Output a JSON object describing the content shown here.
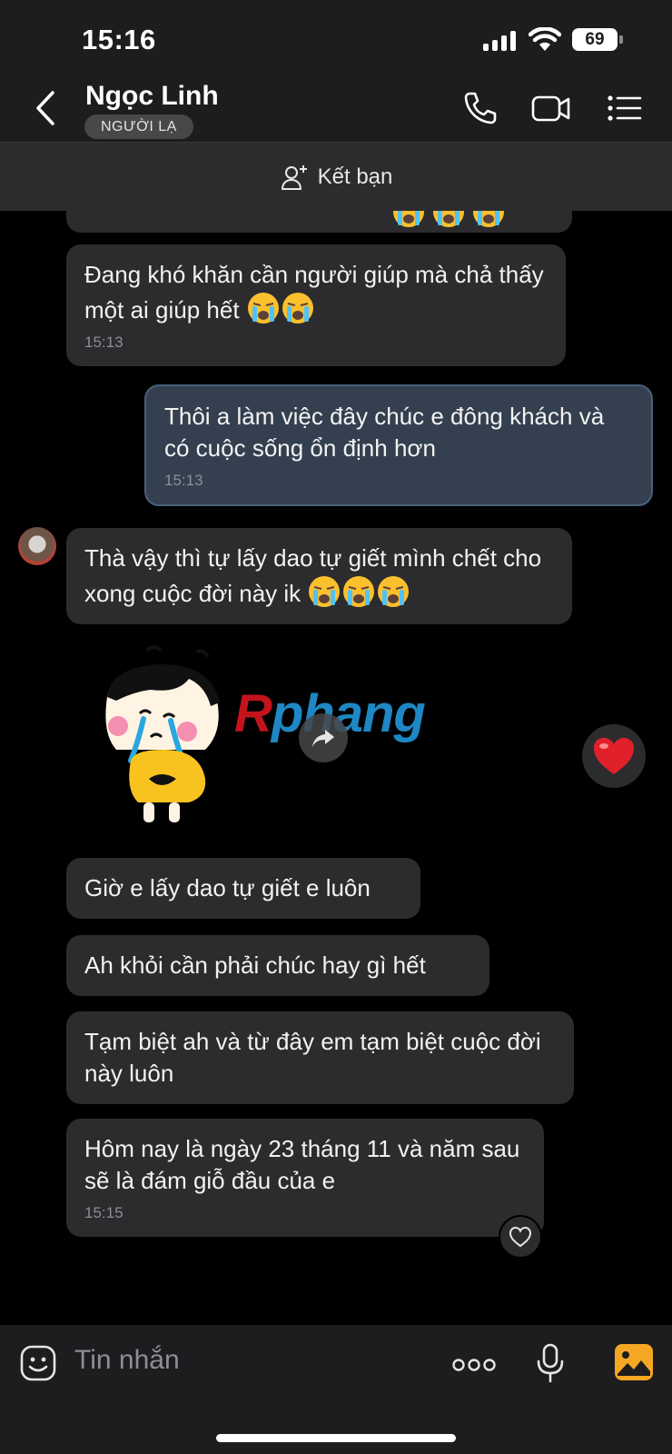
{
  "status": {
    "time": "15:16",
    "battery": "69"
  },
  "header": {
    "contact_name": "Ngọc Linh",
    "badge": "NGƯỜI LẠ"
  },
  "friend_bar": {
    "label": "Kết bạn"
  },
  "messages": [
    {
      "text": "Đang khó khăn cần người giúp mà chả thấy một ai giúp hết",
      "time": "15:13"
    },
    {
      "text": "Thôi a làm việc đây chúc e đông khách và có cuộc sống ổn định hơn",
      "time": "15:13"
    },
    {
      "text": "Thà vậy thì tự lấy dao tự giết mình chết cho xong cuộc đời này ik"
    },
    {
      "text": "Giờ e lấy dao tự giết e luôn"
    },
    {
      "text": "Ah khỏi cần phải chúc hay gì hết"
    },
    {
      "text": "Tạm biệt ah và từ đây em tạm biệt cuộc đời này luôn"
    },
    {
      "text": "Hôm nay là ngày 23 tháng 11 và năm sau sẽ là đám giỗ đầu của e",
      "time": "15:15"
    }
  ],
  "watermark": {
    "part1": "R",
    "part2": "phang"
  },
  "input": {
    "placeholder": "Tin nhắn"
  },
  "colors": {
    "outgoing_bubble": "#34404f",
    "incoming_bubble": "#2c2c2e",
    "accent_orange": "#f5a623",
    "heart_red": "#e0202a"
  }
}
